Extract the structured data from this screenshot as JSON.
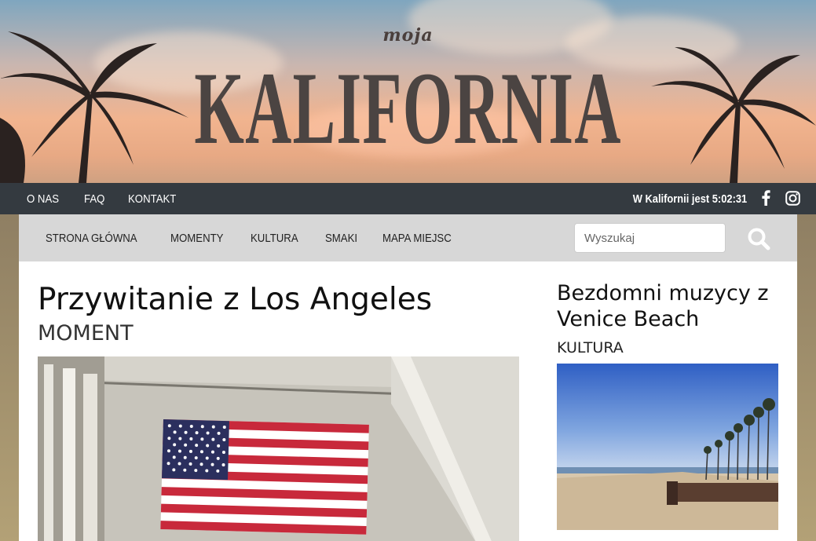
{
  "hero": {
    "small_title": "moja",
    "big_title": "KALIFORNIA"
  },
  "topbar": {
    "links": [
      "O NAS",
      "FAQ",
      "KONTAKT"
    ],
    "clock_text": "W Kalifornii jest 5:02:31",
    "social": [
      "facebook-icon",
      "instagram-icon"
    ]
  },
  "nav": {
    "items": [
      "STRONA GŁÓWNA",
      "MOMENTY",
      "KULTURA",
      "SMAKI",
      "MAPA MIEJSC"
    ],
    "search_placeholder": "Wyszukaj",
    "search_icon": "search-icon"
  },
  "main_article": {
    "title": "Przywitanie z Los Angeles",
    "category": "MOMENT"
  },
  "side_article": {
    "title": "Bezdomni muzycy z Venice Beach",
    "category": "KULTURA"
  },
  "colors": {
    "topbar_bg": "#343a40",
    "nav_bg": "#d7d7d7",
    "title_color": "#4b4442"
  }
}
